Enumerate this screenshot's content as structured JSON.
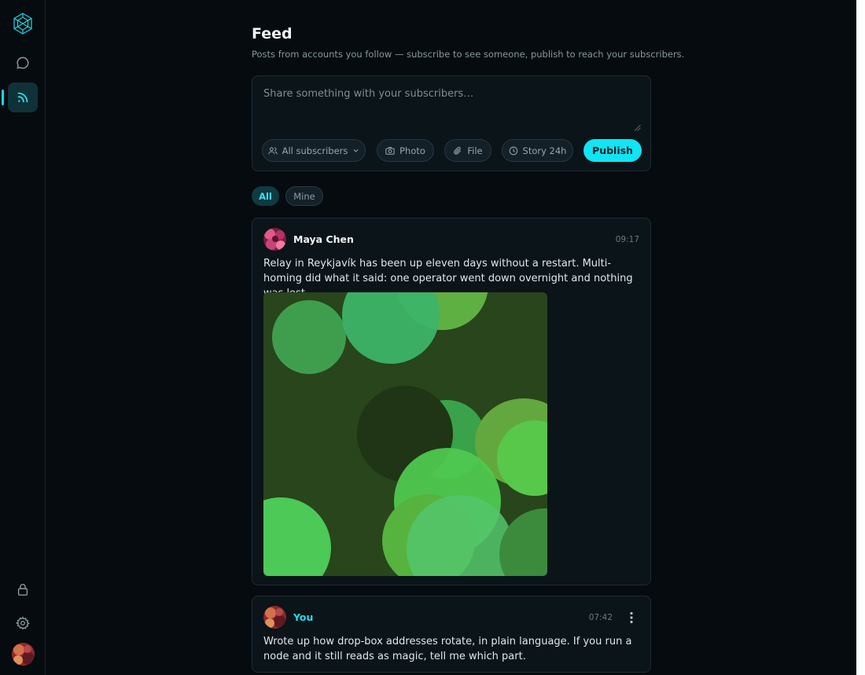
{
  "sidebar": {
    "icons": [
      "logo-icon",
      "chat-icon",
      "feed-icon",
      "lock-icon",
      "gear-icon"
    ],
    "active": "feed",
    "accent": "#13d8e8"
  },
  "page": {
    "title": "Feed",
    "subtitle": "Posts from accounts you follow — subscribe to see someone, publish to reach your subscribers."
  },
  "composer": {
    "placeholder": "Share something with your subscribers…",
    "audience": "All subscribers",
    "photo": "Photo",
    "file": "File",
    "story": "Story 24h",
    "publish": "Publish"
  },
  "filters": {
    "all": "All",
    "mine": "Mine",
    "selected": "All"
  },
  "posts": [
    {
      "author": "Maya Chen",
      "time": "09:17",
      "body": "Relay in Reykjavík has been up eleven days without a restart. Multi-homing did what it said: one operator went down overnight and nothing was lost."
    },
    {
      "author": "You",
      "time": "07:42",
      "body": "Wrote up how drop-box addresses rotate, in plain language. If you run a node and it still reads as magic, tell me which part."
    }
  ],
  "colors": {
    "background": "#060b0f",
    "card": "#0b1419",
    "accent": "#11e4f3"
  }
}
